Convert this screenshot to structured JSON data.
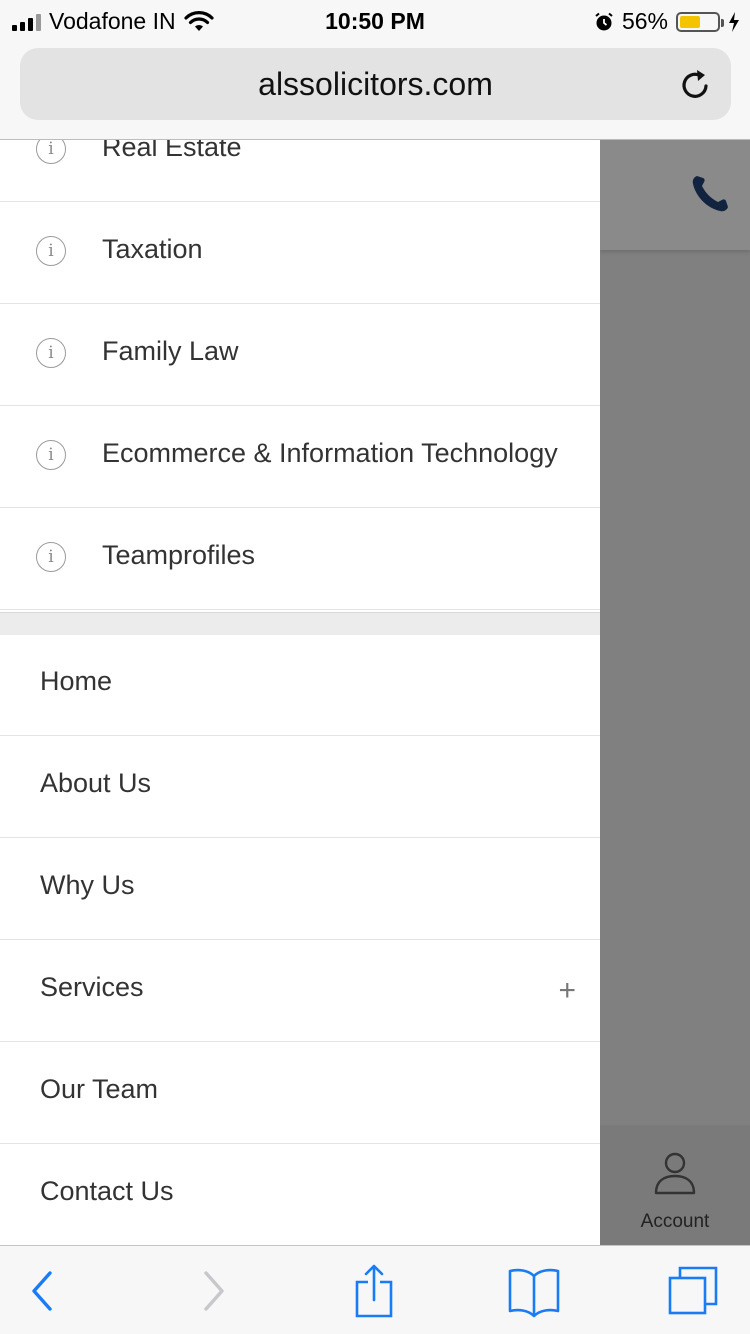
{
  "status_bar": {
    "carrier": "Vodafone IN",
    "time": "10:50 PM",
    "battery_percent": "56%",
    "battery_level": 0.56,
    "icons": [
      "signal-icon",
      "wifi-icon",
      "alarm-icon",
      "battery-icon",
      "charging-icon"
    ]
  },
  "browser": {
    "url": "alssolicitors.com",
    "reload_icon": "reload-icon"
  },
  "drawer": {
    "categories": [
      {
        "label": "Real Estate",
        "icon": "info-icon"
      },
      {
        "label": "Taxation",
        "icon": "info-icon"
      },
      {
        "label": "Family Law",
        "icon": "info-icon"
      },
      {
        "label": "Ecommerce & Information Technology",
        "icon": "info-icon"
      },
      {
        "label": "Teamprofiles",
        "icon": "info-icon"
      }
    ],
    "nav": [
      {
        "label": "Home"
      },
      {
        "label": "About Us"
      },
      {
        "label": "Why Us"
      },
      {
        "label": "Services",
        "expand_icon": "+"
      },
      {
        "label": "Our Team"
      },
      {
        "label": "Contact Us"
      }
    ]
  },
  "page": {
    "phone_icon": "phone-icon",
    "account_label": "Account"
  },
  "toolbar": {
    "icons": [
      "back-icon",
      "forward-icon",
      "share-icon",
      "bookmarks-icon",
      "tabs-icon"
    ]
  },
  "colors": {
    "accent_blue": "#1a7cf5",
    "phone_navy": "#12233f",
    "battery_yellow": "#f5c400",
    "overlay_gray": "#808080"
  }
}
